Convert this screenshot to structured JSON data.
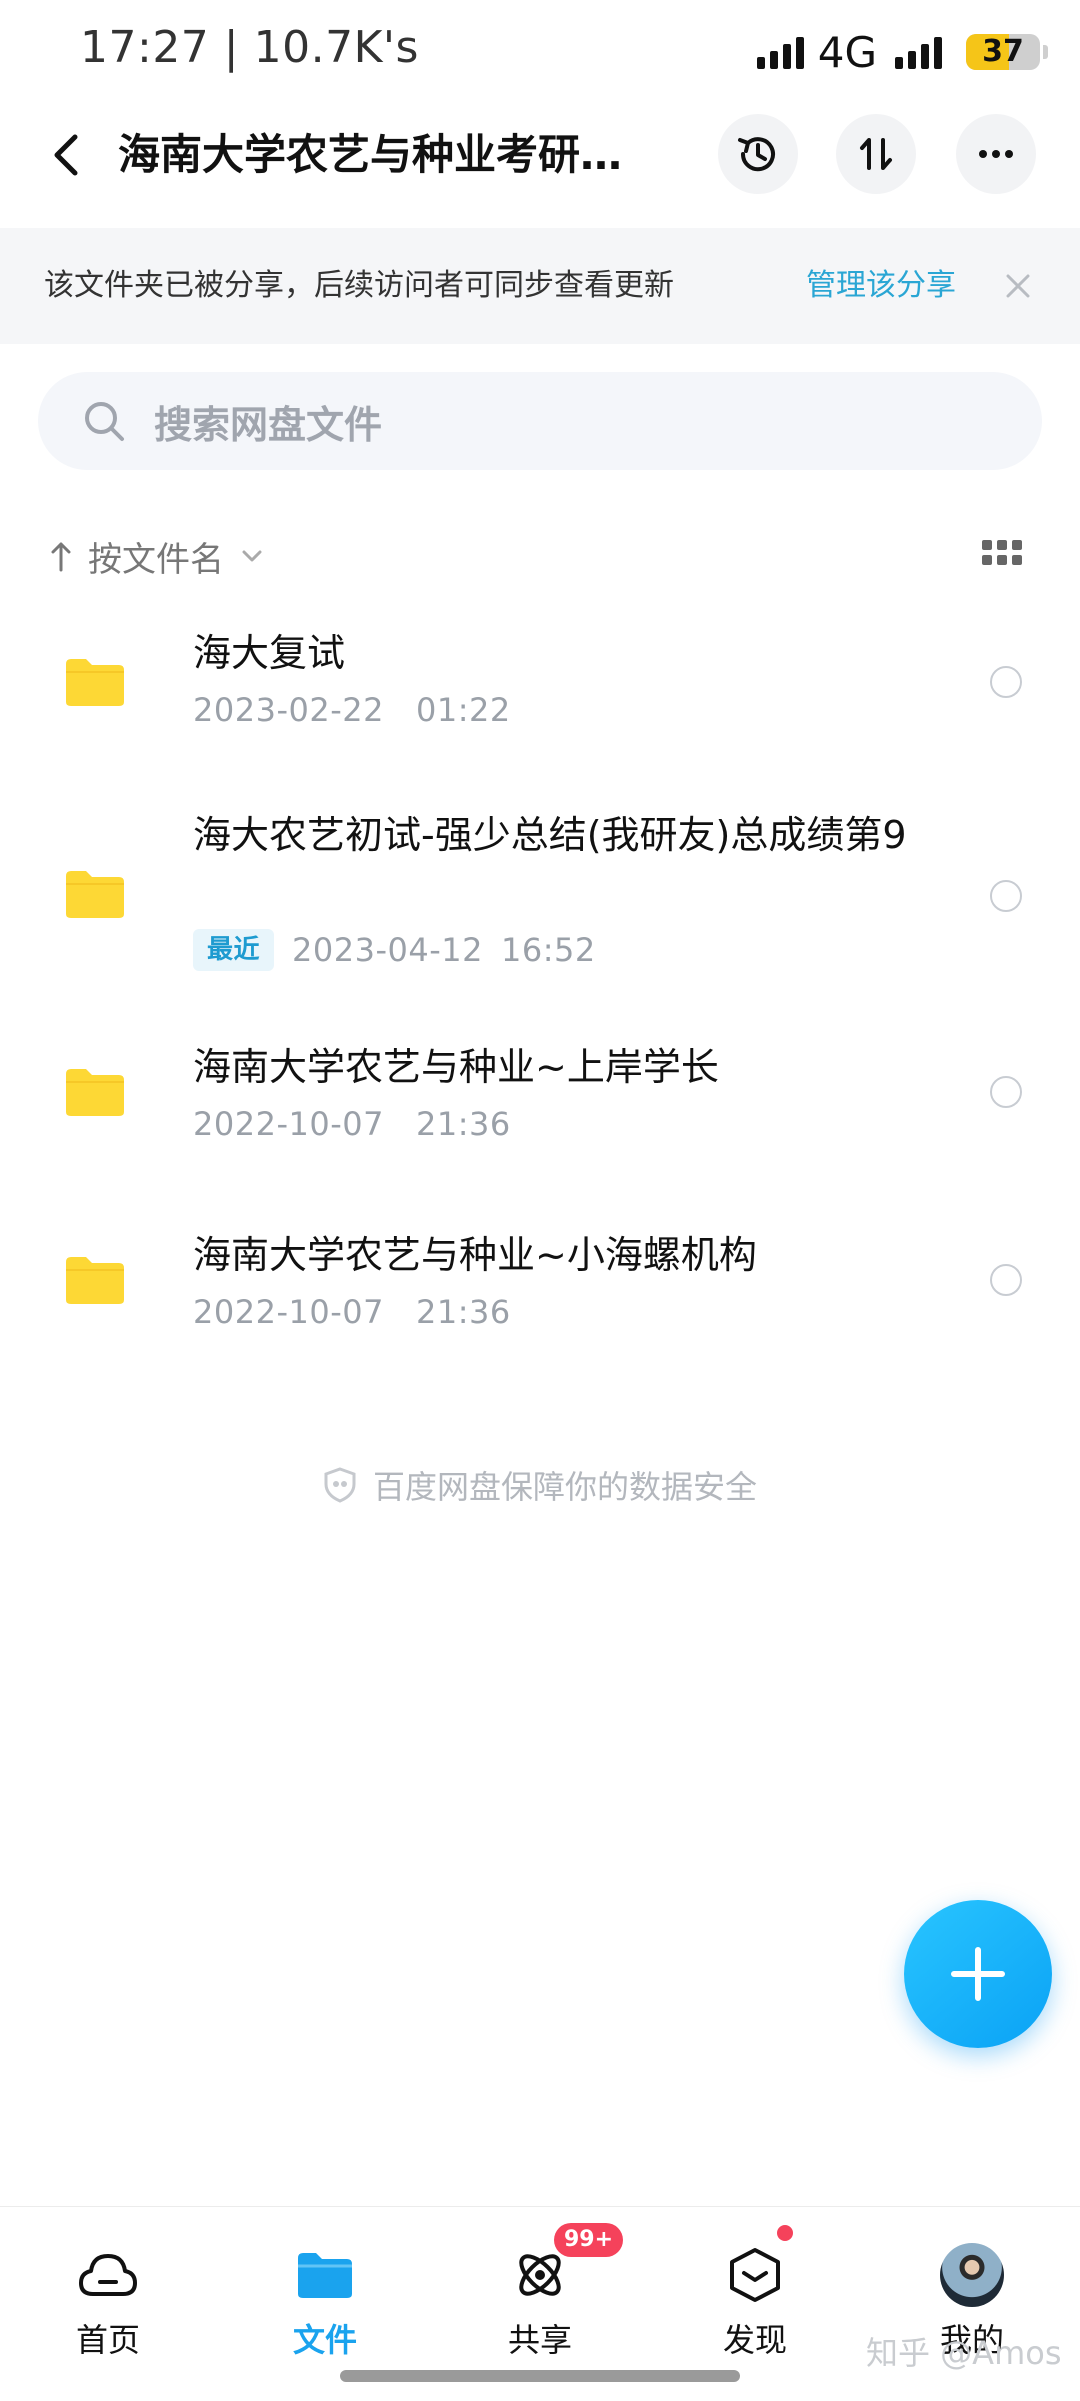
{
  "status_bar": {
    "time_speed": "17:27 | 10.7K's",
    "network": "4G",
    "battery": "37"
  },
  "header": {
    "title": "海南大学农艺与种业考研资料",
    "icons": [
      "back-icon",
      "history-icon",
      "sort-transfer-icon",
      "more-icon"
    ]
  },
  "share_banner": {
    "message": "该文件夹已被分享，后续访问者可同步查看更新",
    "action": "管理该分享"
  },
  "search": {
    "placeholder": "搜索网盘文件"
  },
  "sort": {
    "label": "按文件名"
  },
  "files": [
    {
      "name": "海大复试",
      "date": "2023-02-22",
      "time": "01:22"
    },
    {
      "name": "海大农艺初试-强少总结(我研友)总成绩第9",
      "tag": "最近",
      "date": "2023-04-12",
      "time": "16:52"
    },
    {
      "name": "海南大学农艺与种业~上岸学长",
      "date": "2022-10-07",
      "time": "21:36"
    },
    {
      "name": "海南大学农艺与种业~小海螺机构",
      "date": "2022-10-07",
      "time": "21:36"
    }
  ],
  "safety_note": "百度网盘保障你的数据安全",
  "bottom_nav": [
    {
      "label": "首页",
      "icon": "cloud-home-icon"
    },
    {
      "label": "文件",
      "icon": "folder-icon",
      "active": true
    },
    {
      "label": "共享",
      "icon": "share-orbit-icon",
      "badge": "99+"
    },
    {
      "label": "发现",
      "icon": "discover-box-icon",
      "dot": true
    },
    {
      "label": "我的",
      "icon": "avatar"
    }
  ],
  "watermark": "知乎 @Amos",
  "colors": {
    "accent": "#1aa3ee",
    "link": "#2aa6d4",
    "folder": "#fdd835",
    "badge": "#f5425b"
  }
}
